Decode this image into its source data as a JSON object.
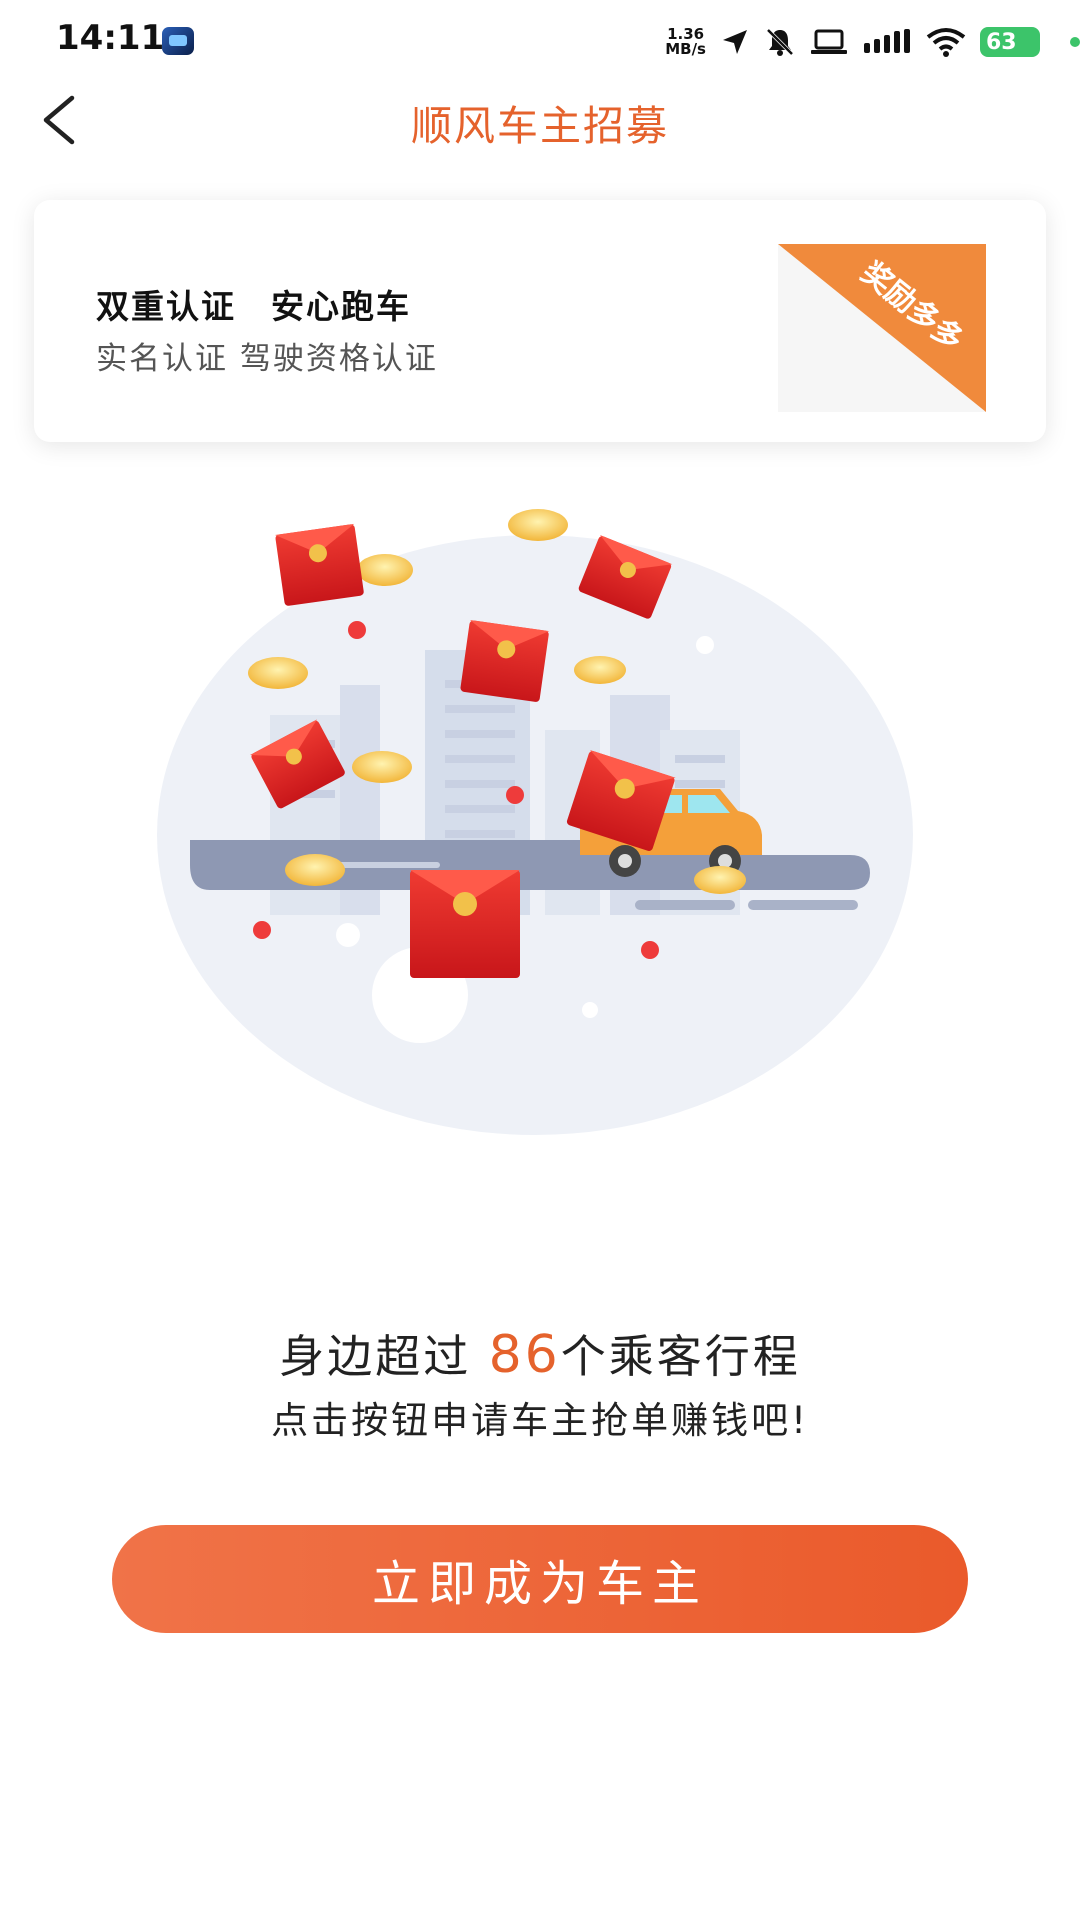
{
  "status_bar": {
    "time": "14:11",
    "net_speed_value": "1.36",
    "net_speed_unit": "MB/s",
    "battery": "63",
    "icons": [
      "app-icon",
      "location-arrow-icon",
      "mute-icon",
      "laptop-icon",
      "signal-icon",
      "wifi-icon",
      "battery-icon"
    ]
  },
  "header": {
    "title": "顺风车主招募",
    "back_icon": "chevron-left-icon"
  },
  "info_card": {
    "title": "双重认证　安心跑车",
    "subtitle": "实名认证  驾驶资格认证",
    "badge": "奖励多多"
  },
  "promo": {
    "prefix": "身边超过 ",
    "count": "86",
    "suffix": "个乘客行程",
    "line2": "点击按钮申请车主抢单赚钱吧!"
  },
  "cta": {
    "label": "立即成为车主"
  },
  "colors": {
    "accent": "#e5622c",
    "badge": "#f08a3c",
    "button_start": "#f07348",
    "button_end": "#ea5a2b"
  }
}
